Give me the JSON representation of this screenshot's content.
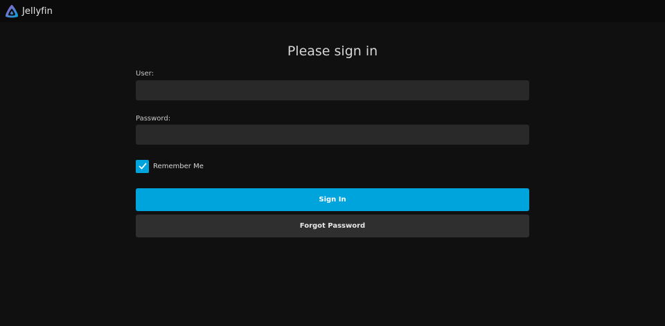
{
  "app": {
    "name": "Jellyfin",
    "accent_color": "#00a4dc"
  },
  "login": {
    "title": "Please sign in",
    "user_label": "User:",
    "user_value": "",
    "password_label": "Password:",
    "password_value": "",
    "remember_me_label": "Remember Me",
    "remember_me_checked": true,
    "sign_in_label": "Sign In",
    "forgot_password_label": "Forgot Password"
  }
}
